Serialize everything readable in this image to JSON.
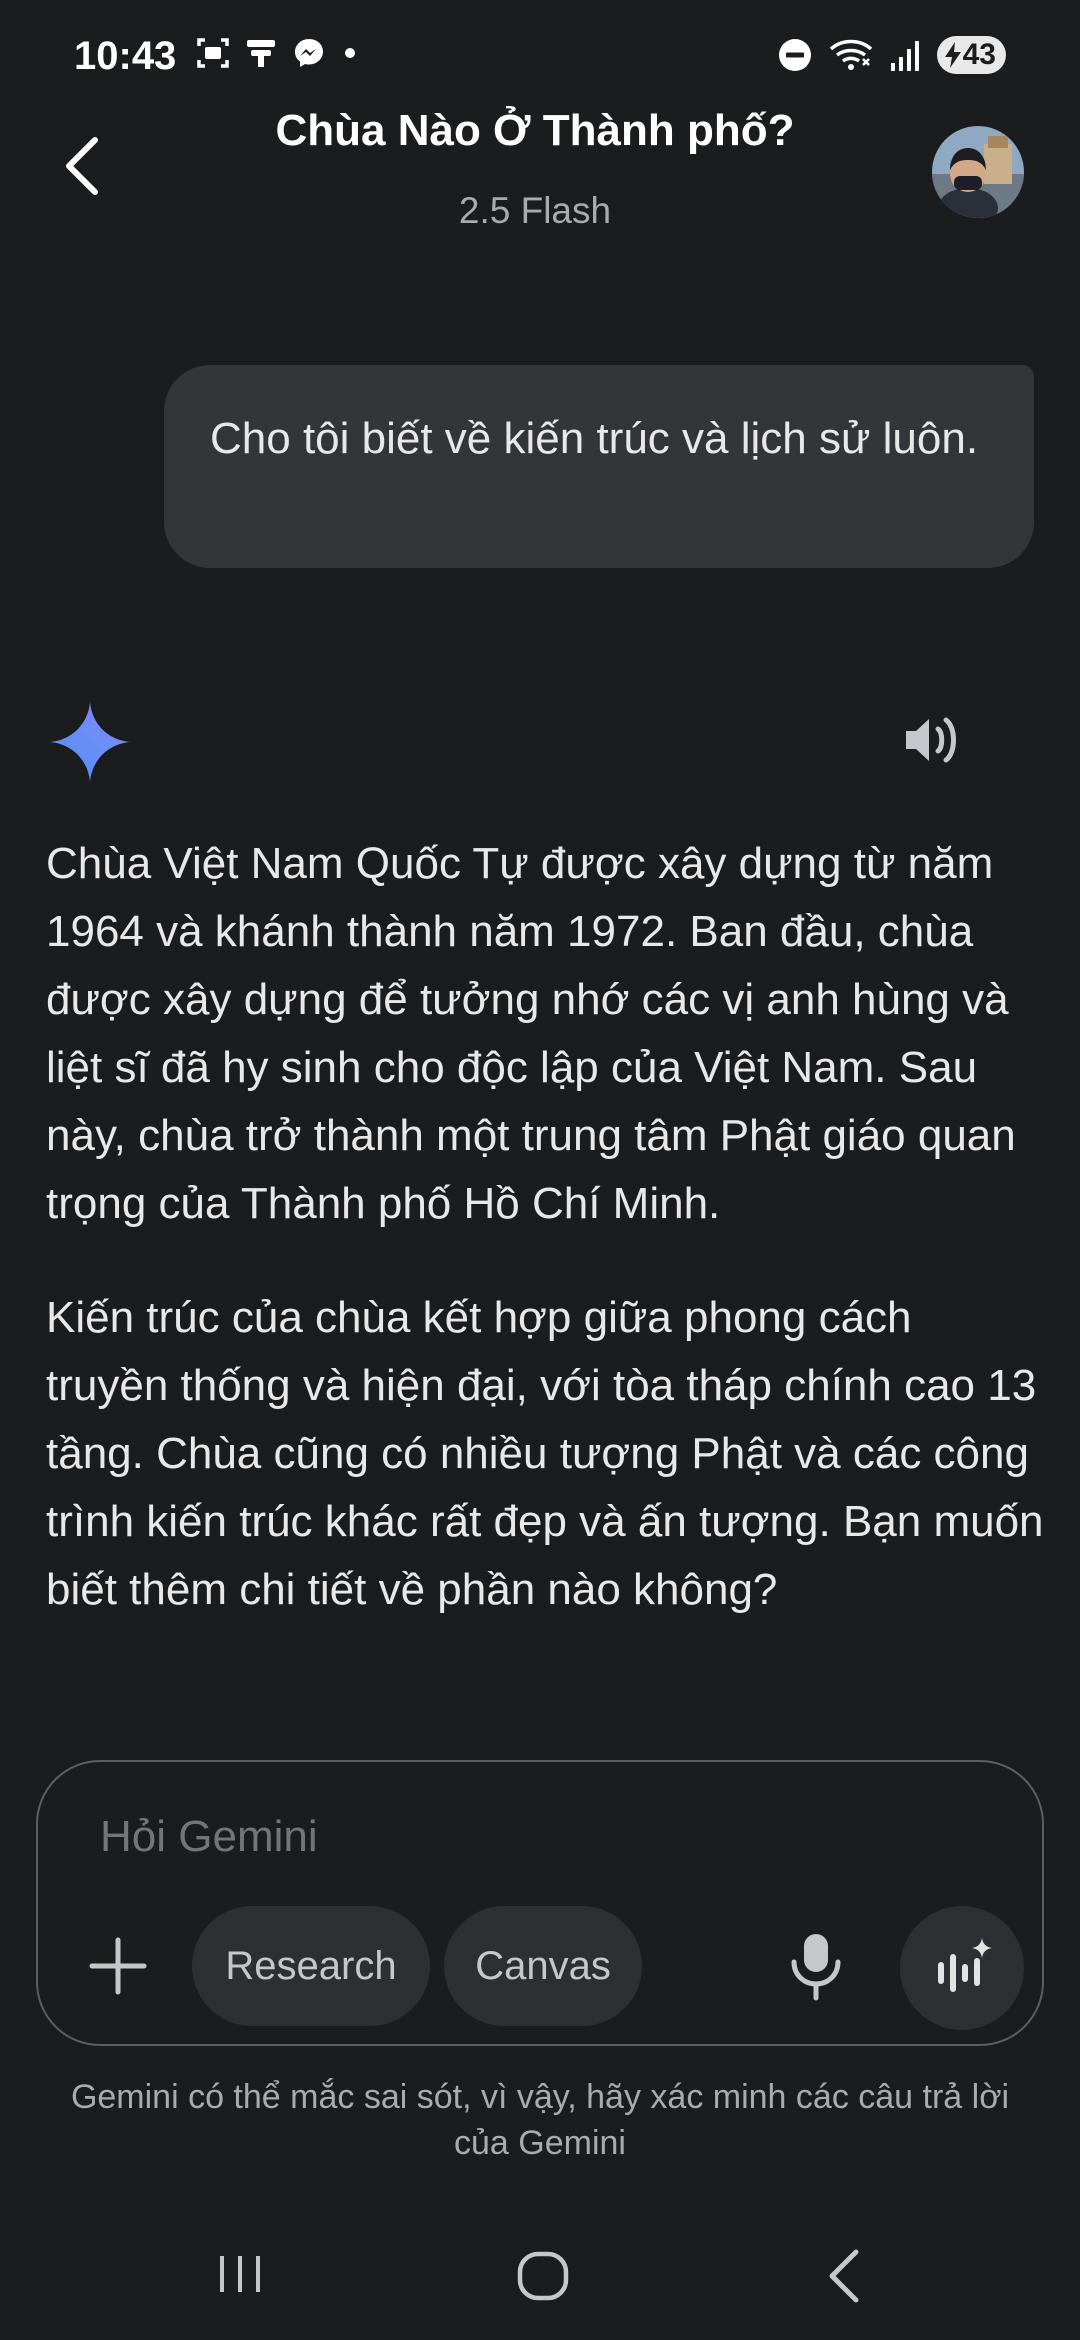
{
  "status_bar": {
    "time": "10:43",
    "battery": "43",
    "left_icons": [
      "screenshot-icon",
      "nfc-icon",
      "messenger-icon",
      "dot-icon"
    ],
    "right_icons": [
      "dnd-icon",
      "wifi-icon",
      "signal-icon",
      "battery-charging-icon"
    ]
  },
  "header": {
    "title": "Chùa Nào Ở Thành phố?",
    "model": "2.5 Flash"
  },
  "conversation": {
    "user_message": "Cho tôi biết về kiến trúc và lịch sử luôn.",
    "response_paragraphs": [
      "Chùa Việt Nam Quốc Tự được xây dựng từ năm 1964 và khánh thành năm 1972. Ban đầu, chùa được xây dựng để tưởng nhớ các vị anh hùng và liệt sĩ đã hy sinh cho độc lập của Việt Nam. Sau này, chùa trở thành một trung tâm Phật giáo quan trọng của Thành phố Hồ Chí Minh.",
      "Kiến trúc của chùa kết hợp giữa phong cách truyền thống và hiện đại, với tòa tháp chính cao 13 tầng. Chùa cũng có nhiều tượng Phật và các công trình kiến trúc khác rất đẹp và ấn tượng. Bạn muốn biết thêm chi tiết về phần nào không?"
    ]
  },
  "composer": {
    "placeholder": "Hỏi Gemini",
    "research_label": "Research",
    "canvas_label": "Canvas"
  },
  "disclaimer": "Gemini có thể mắc sai sót, vì vậy, hãy xác minh các câu trả lời của Gemini",
  "colors": {
    "background": "#1b1c1e",
    "bubble": "#333538",
    "chip": "#2d2f32",
    "gemini_blue": "#4e8cf7",
    "gemini_purple": "#9b72f5"
  }
}
